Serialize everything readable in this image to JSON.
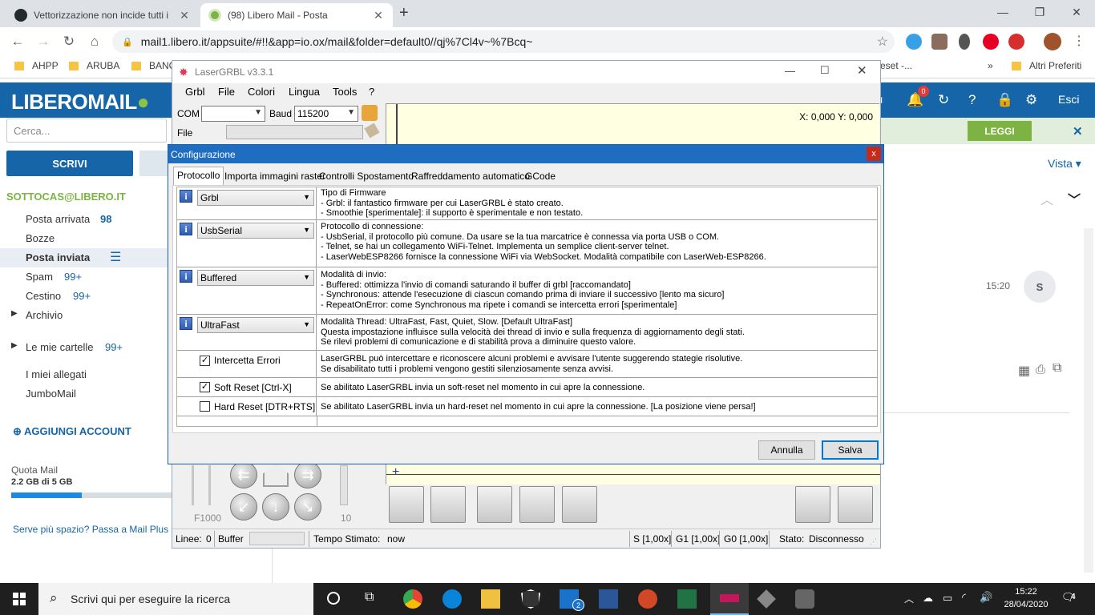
{
  "browser": {
    "tabs": [
      {
        "title": "Vettorizzazione non incide tutti i",
        "active": false
      },
      {
        "title": "(98) Libero Mail - Posta",
        "active": true
      }
    ],
    "new_tab": "+",
    "url": "mail1.libero.it/appsuite/#!!&app=io.ox/mail&folder=default0//qj%7Cl4v~%7Bcq~",
    "bookmarks": [
      "AHPP",
      "ARUBA",
      "BANC"
    ],
    "bookmarks_right": [
      "eset -...",
      "»"
    ],
    "other_bookmarks": "Altri Preferiti"
  },
  "libero": {
    "logo_a": "LIBERO",
    "logo_b": "MAIL",
    "logout": "Esci",
    "notif_badge": "0",
    "search_placeholder": "Cerca...",
    "compose": "SCRIVI",
    "account": "SOTTOCAS@LIBERO.IT",
    "folders": [
      {
        "label": "Posta arrivata",
        "count": "98"
      },
      {
        "label": "Bozze",
        "count": ""
      },
      {
        "label": "Posta inviata",
        "count": ""
      },
      {
        "label": "Spam",
        "count": "99+"
      },
      {
        "label": "Cestino",
        "count": "99+"
      },
      {
        "label": "Archivio",
        "count": ""
      },
      {
        "label": "Le mie cartelle",
        "count": "99+"
      },
      {
        "label": "I miei allegati",
        "count": ""
      },
      {
        "label": "JumboMail",
        "count": ""
      }
    ],
    "add_account": "AGGIUNGI ACCOUNT",
    "quota_label": "Quota Mail",
    "quota_value": "2.2 GB di 5 GB",
    "quota_fraction": 0.44,
    "more_space": "Serve più spazio? Passa a Mail Plus",
    "leggi": "LEGGI",
    "vista": "Vista",
    "msg_time": "15:20",
    "avatar_letter": "S"
  },
  "laser": {
    "title": "LaserGRBL v3.3.1",
    "menu": [
      "Grbl",
      "File",
      "Colori",
      "Lingua",
      "Tools",
      "?"
    ],
    "com_label": "COM",
    "com_value": "",
    "baud_label": "Baud",
    "baud_value": "115200",
    "file_label": "File",
    "coords": "X: 0,000 Y: 0,000",
    "f_label": "F1000",
    "step_label": "10",
    "status": {
      "linee_label": "Linee:",
      "linee_value": "0",
      "buffer_label": "Buffer",
      "tempo_label": "Tempo Stimato:",
      "tempo_value": "now",
      "s": "S [1,00x]",
      "g1": "G1 [1,00x]",
      "g0": "G0 [1,00x]",
      "stato_label": "Stato:",
      "stato_value": "Disconnesso"
    }
  },
  "dialog": {
    "title": "Configurazione",
    "close": "x",
    "tabs": [
      "Protocollo",
      "Importa immagini raster",
      "Controlli Spostamento",
      "Raffreddamento automatico",
      "GCode"
    ],
    "rows": {
      "firmware": {
        "value": "Grbl",
        "lines": [
          "Tipo di Firmware",
          "- Grbl: il fantastico firmware per cui LaserGRBL è stato creato.",
          "- Smoothie [sperimentale]: il supporto è sperimentale e non testato."
        ]
      },
      "protocol": {
        "value": "UsbSerial",
        "lines": [
          "Protocollo di connessione:",
          "- UsbSerial, il protocollo più comune. Da usare se la tua marcatrice è connessa via porta USB o COM.",
          "- Telnet, se hai un collegamento WiFi-Telnet. Implementa un semplice client-server telnet.",
          "- LaserWebESP8266 fornisce la connessione WiFi via WebSocket. Modalità compatibile con LaserWeb-ESP8266."
        ]
      },
      "sendmode": {
        "value": "Buffered",
        "lines": [
          "Modalità di invio:",
          "- Buffered: ottimizza l'invio di comandi  saturando il buffer di grbl [raccomandato]",
          "- Synchronous: attende l'esecuzione di ciascun comando prima di inviare il successivo [lento ma sicuro]",
          "- RepeatOnError: come Synchronous ma ripete i comandi se intercetta errori [sperimentale]"
        ]
      },
      "thread": {
        "value": "UltraFast",
        "lines": [
          "Modalità Thread: UltraFast, Fast, Quiet, Slow. [Default UltraFast]",
          "Questa impostazione influisce sulla velocità dei thread di invio e sulla frequenza di aggiornamento degli stati.",
          "Se rilevi problemi di comunicazione e di stabilità prova a diminuire questo valore."
        ]
      },
      "errors": {
        "label": "Intercetta Errori",
        "checked": true,
        "lines": [
          "LaserGRBL può intercettare e riconoscere alcuni problemi e avvisare l'utente suggerendo stategie risolutive.",
          "Se disabilitato tutti i problemi vengono gestiti silenziosamente senza avvisi."
        ]
      },
      "softreset": {
        "label": "Soft Reset [Ctrl-X]",
        "checked": true,
        "lines": [
          "Se abilitato LaserGRBL invia un soft-reset nel momento in cui apre la connessione."
        ]
      },
      "hardreset": {
        "label": "Hard Reset [DTR+RTS]",
        "checked": false,
        "lines": [
          "Se abilitato LaserGRBL invia un hard-reset nel momento in cui apre la connessione. [La posizione viene persa!]"
        ]
      }
    },
    "cancel": "Annulla",
    "save": "Salva"
  },
  "taskbar": {
    "search_placeholder": "Scrivi qui per eseguire la ricerca",
    "outlook_badge": "2",
    "time": "15:22",
    "date": "28/04/2020",
    "notif_count": "4"
  },
  "colors": {
    "libero_blue": "#1565a8",
    "libero_green": "#8bc34a",
    "dialog_title": "#1e6dc0",
    "viewer_yellow": "#ffffe1"
  }
}
